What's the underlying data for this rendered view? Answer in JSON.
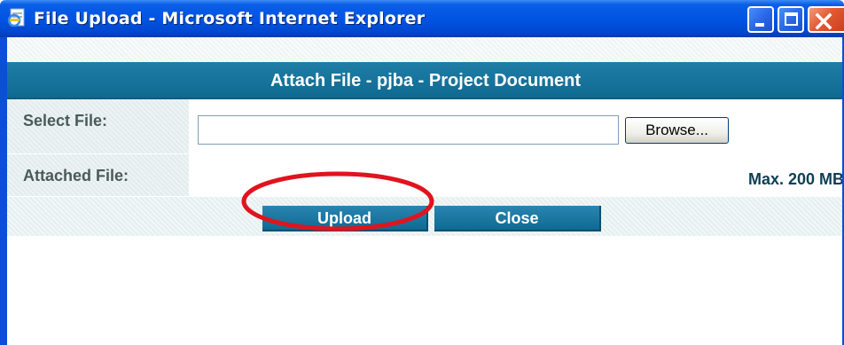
{
  "window": {
    "title": "File Upload - Microsoft Internet Explorer",
    "icon": "ie-page-icon",
    "controls": [
      "minimize-icon",
      "maximize-icon",
      "close-icon"
    ],
    "title_color": "#0054e3"
  },
  "dialog": {
    "header": "Attach File - pjba - Project Document",
    "header_color": "#0f6a92",
    "select_file": {
      "label": "Select File:",
      "input_value": "",
      "browse_label": "Browse..."
    },
    "attached_file": {
      "label": "Attached File:",
      "max_size": "Max. 200 MB"
    },
    "buttons": {
      "upload_label": "Upload",
      "close_label": "Close"
    },
    "annotation_color": "#e0141e"
  }
}
